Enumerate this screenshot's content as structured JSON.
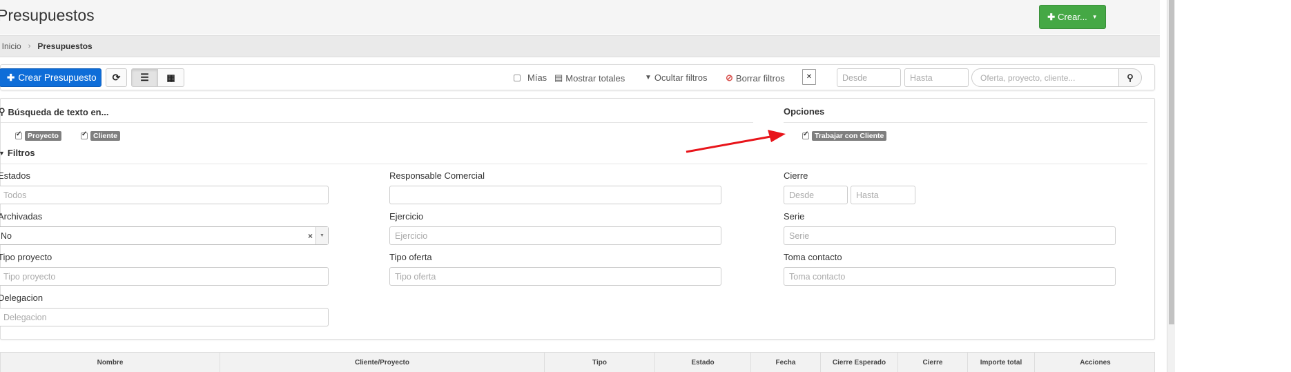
{
  "header": {
    "title": "Presupuestos",
    "create_button": "Crear...",
    "create_icon": "plus-icon"
  },
  "breadcrumb": {
    "home": "Inicio",
    "current": "Presupuestos"
  },
  "toolbar": {
    "new_button": "Crear Presupuesto",
    "mias_label": "Mías",
    "show_totals": "Mostrar totales",
    "hide_filters": "Ocultar filtros",
    "clear_filters": "Borrar filtros",
    "from_placeholder": "Desde",
    "to_placeholder": "Hasta",
    "search_placeholder": "Oferta, proyecto, cliente...",
    "clear_color": "#d9534f"
  },
  "text_search": {
    "title": "Búsqueda de texto en...",
    "options": [
      {
        "label": "Proyecto",
        "checked": true
      },
      {
        "label": "Cliente",
        "checked": true
      }
    ]
  },
  "options": {
    "title": "Opciones",
    "items": [
      {
        "label": "Trabajar con Cliente",
        "checked": true
      }
    ]
  },
  "filters": {
    "title": "Filtros",
    "estados": {
      "label": "Estados",
      "placeholder": "Todos"
    },
    "responsable": {
      "label": "Responsable Comercial",
      "placeholder": ""
    },
    "cierre": {
      "label": "Cierre",
      "from": "Desde",
      "to": "Hasta"
    },
    "archivadas": {
      "label": "Archivadas",
      "value": "No"
    },
    "ejercicio": {
      "label": "Ejercicio",
      "placeholder": "Ejercicio"
    },
    "serie": {
      "label": "Serie",
      "placeholder": "Serie"
    },
    "tipo_proyecto": {
      "label": "Tipo proyecto",
      "placeholder": "Tipo proyecto"
    },
    "tipo_oferta": {
      "label": "Tipo oferta",
      "placeholder": "Tipo oferta"
    },
    "toma_contacto": {
      "label": "Toma contacto",
      "placeholder": "Toma contacto"
    },
    "delegacion": {
      "label": "Delegacion",
      "placeholder": "Delegacion"
    }
  },
  "table": {
    "columns": [
      "Nombre",
      "Cliente/Proyecto",
      "Tipo",
      "Estado",
      "Fecha",
      "Cierre Esperado",
      "Cierre",
      "Importe total",
      "Acciones"
    ]
  },
  "colors": {
    "primary": "#0e6dd8",
    "success": "#45a845",
    "annotation_arrow": "#e8141a"
  }
}
